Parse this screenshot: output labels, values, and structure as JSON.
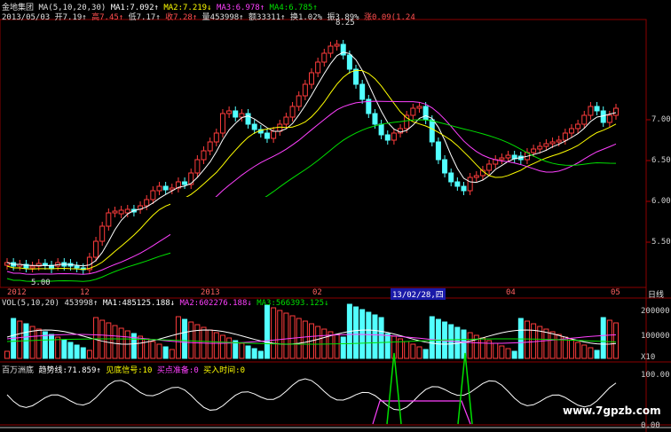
{
  "header": {
    "stock_name": "金地集团",
    "ma_title": "MA(5,10,20,30)",
    "ma1": "MA1:7.092↑",
    "ma2": "MA2:7.219↓",
    "ma3": "MA3:6.978↑",
    "ma4": "MA4:6.785↑",
    "date": "2013/05/03",
    "open": "开7.19↑",
    "high": "高7.45↑",
    "low": "低7.17↑",
    "close": "收7.28↑",
    "volume": "量453998↑",
    "amount": "额33311↑",
    "turnover": "换1.02%",
    "amplitude": "振3.89%",
    "change": "涨0.09(1.24"
  },
  "price_panel": {
    "y_ticks": [
      "7.00",
      "6.50",
      "6.00",
      "5.50"
    ],
    "high_mark": "8.25",
    "low_mark": "5.00",
    "x_labels": [
      "2012",
      "12",
      "2013",
      "02",
      "04",
      "05"
    ],
    "cursor_date": "13/02/28,四",
    "period": "日线"
  },
  "volume_panel": {
    "title": "VOL(5,10,20)",
    "vol": "453998↑",
    "ma1": "MA1:485125.188↓",
    "ma2": "MA2:602276.188↓",
    "ma3": "MA3:566393.125↓",
    "y_ticks": [
      "200000",
      "100000"
    ],
    "unit": "X10"
  },
  "indicator_panel": {
    "name": "百万洲底",
    "trend": "趋势线:71.859↑",
    "signal": "见底信号:10",
    "buy_ready": "买点准备:0",
    "buy_time": "买入时间:0",
    "y_ticks": [
      "100.00",
      "0.00"
    ]
  },
  "watermark": "www.7gpzb.com",
  "colors": {
    "up": "#ff3c3c",
    "down": "#52ffff",
    "ma1": "#ffffff",
    "ma2": "#ffff00",
    "ma3": "#ff40ff",
    "ma4": "#00e000",
    "grid": "#8b0000"
  }
}
